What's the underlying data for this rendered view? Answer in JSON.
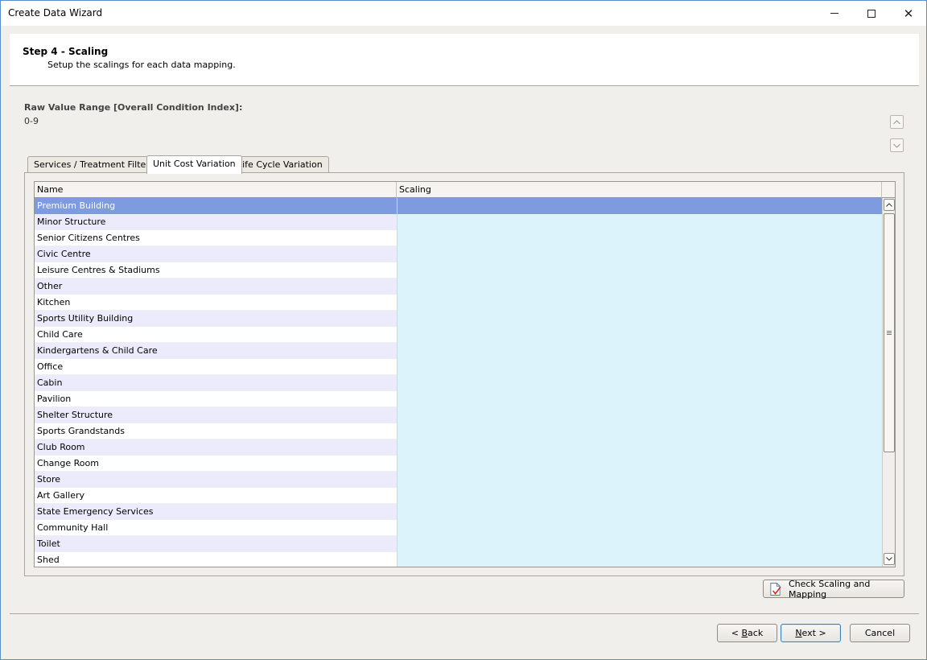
{
  "window": {
    "title": "Create Data Wizard",
    "minimize_glyph": "minimize-icon",
    "maximize_glyph": "maximize-icon",
    "close_glyph": "✕"
  },
  "header": {
    "step_title": "Step 4 - Scaling",
    "step_subtitle": "Setup the scalings for each data mapping."
  },
  "raw_range": {
    "label": "Raw Value Range [Overall Condition Index]:",
    "value": "0-9"
  },
  "tabs": [
    {
      "label": "Services / Treatment Filters",
      "active": false
    },
    {
      "label": "Unit Cost Variation",
      "active": true
    },
    {
      "label": "Life Cycle Variation",
      "active": false
    }
  ],
  "grid": {
    "columns": [
      "Name",
      "Scaling"
    ],
    "rows": [
      {
        "name": "Premium Building",
        "scaling": ""
      },
      {
        "name": "Minor Structure",
        "scaling": ""
      },
      {
        "name": "Senior Citizens Centres",
        "scaling": ""
      },
      {
        "name": "Civic Centre",
        "scaling": ""
      },
      {
        "name": "Leisure Centres & Stadiums",
        "scaling": ""
      },
      {
        "name": "Other",
        "scaling": ""
      },
      {
        "name": "Kitchen",
        "scaling": ""
      },
      {
        "name": "Sports Utility Building",
        "scaling": ""
      },
      {
        "name": "Child Care",
        "scaling": ""
      },
      {
        "name": "Kindergartens & Child Care",
        "scaling": ""
      },
      {
        "name": "Office",
        "scaling": ""
      },
      {
        "name": "Cabin",
        "scaling": ""
      },
      {
        "name": "Pavilion",
        "scaling": ""
      },
      {
        "name": "Shelter Structure",
        "scaling": ""
      },
      {
        "name": "Sports Grandstands",
        "scaling": ""
      },
      {
        "name": "Club Room",
        "scaling": ""
      },
      {
        "name": "Change Room",
        "scaling": ""
      },
      {
        "name": "Store",
        "scaling": ""
      },
      {
        "name": "Art Gallery",
        "scaling": ""
      },
      {
        "name": "State Emergency Services",
        "scaling": ""
      },
      {
        "name": "Community Hall",
        "scaling": ""
      },
      {
        "name": "Toilet",
        "scaling": ""
      },
      {
        "name": "Shed",
        "scaling": ""
      }
    ],
    "selected_row": 0
  },
  "buttons": {
    "check_scaling": "Check Scaling and Mapping",
    "back_prefix": "< ",
    "back_key": "B",
    "back_rest": "ack",
    "next_key": "N",
    "next_rest": "ext >",
    "cancel": "Cancel"
  },
  "colors": {
    "selected_row": "#7f9be0",
    "alt_row": "#ebebfb",
    "scaling_cell": "#ddf3fb"
  }
}
